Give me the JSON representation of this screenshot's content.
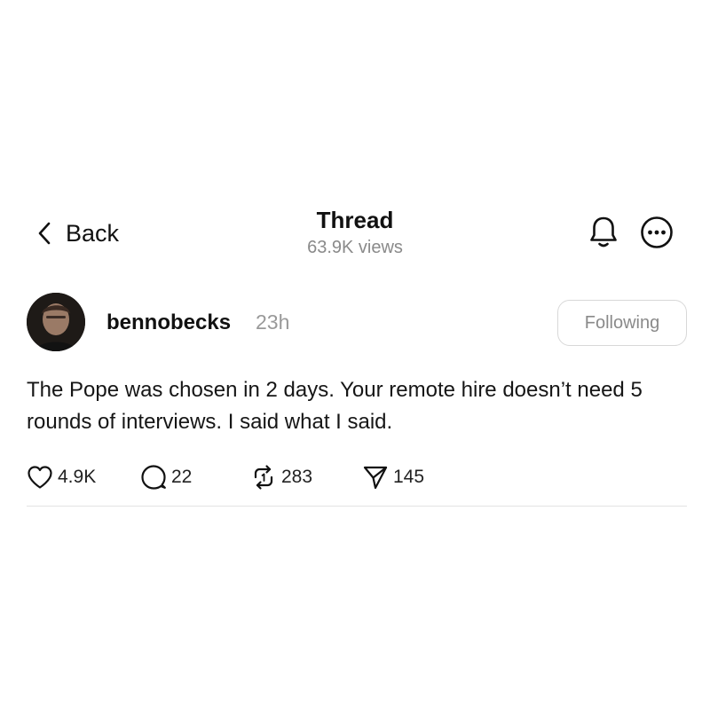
{
  "header": {
    "back_label": "Back",
    "title": "Thread",
    "views": "63.9K views",
    "icons": [
      "chevron-left-icon",
      "bell-icon",
      "more-options-icon"
    ]
  },
  "post": {
    "username": "bennobecks",
    "timestamp": "23h",
    "follow_status": "Following",
    "body": "The Pope was chosen in 2 days. Your remote hire doesn’t need 5 rounds of interviews. I said what I said.",
    "counts": {
      "likes": "4.9K",
      "replies": "22",
      "reposts": "283",
      "shares": "145"
    },
    "action_icons": [
      "heart-icon",
      "comment-icon",
      "repost-icon",
      "send-icon"
    ]
  }
}
